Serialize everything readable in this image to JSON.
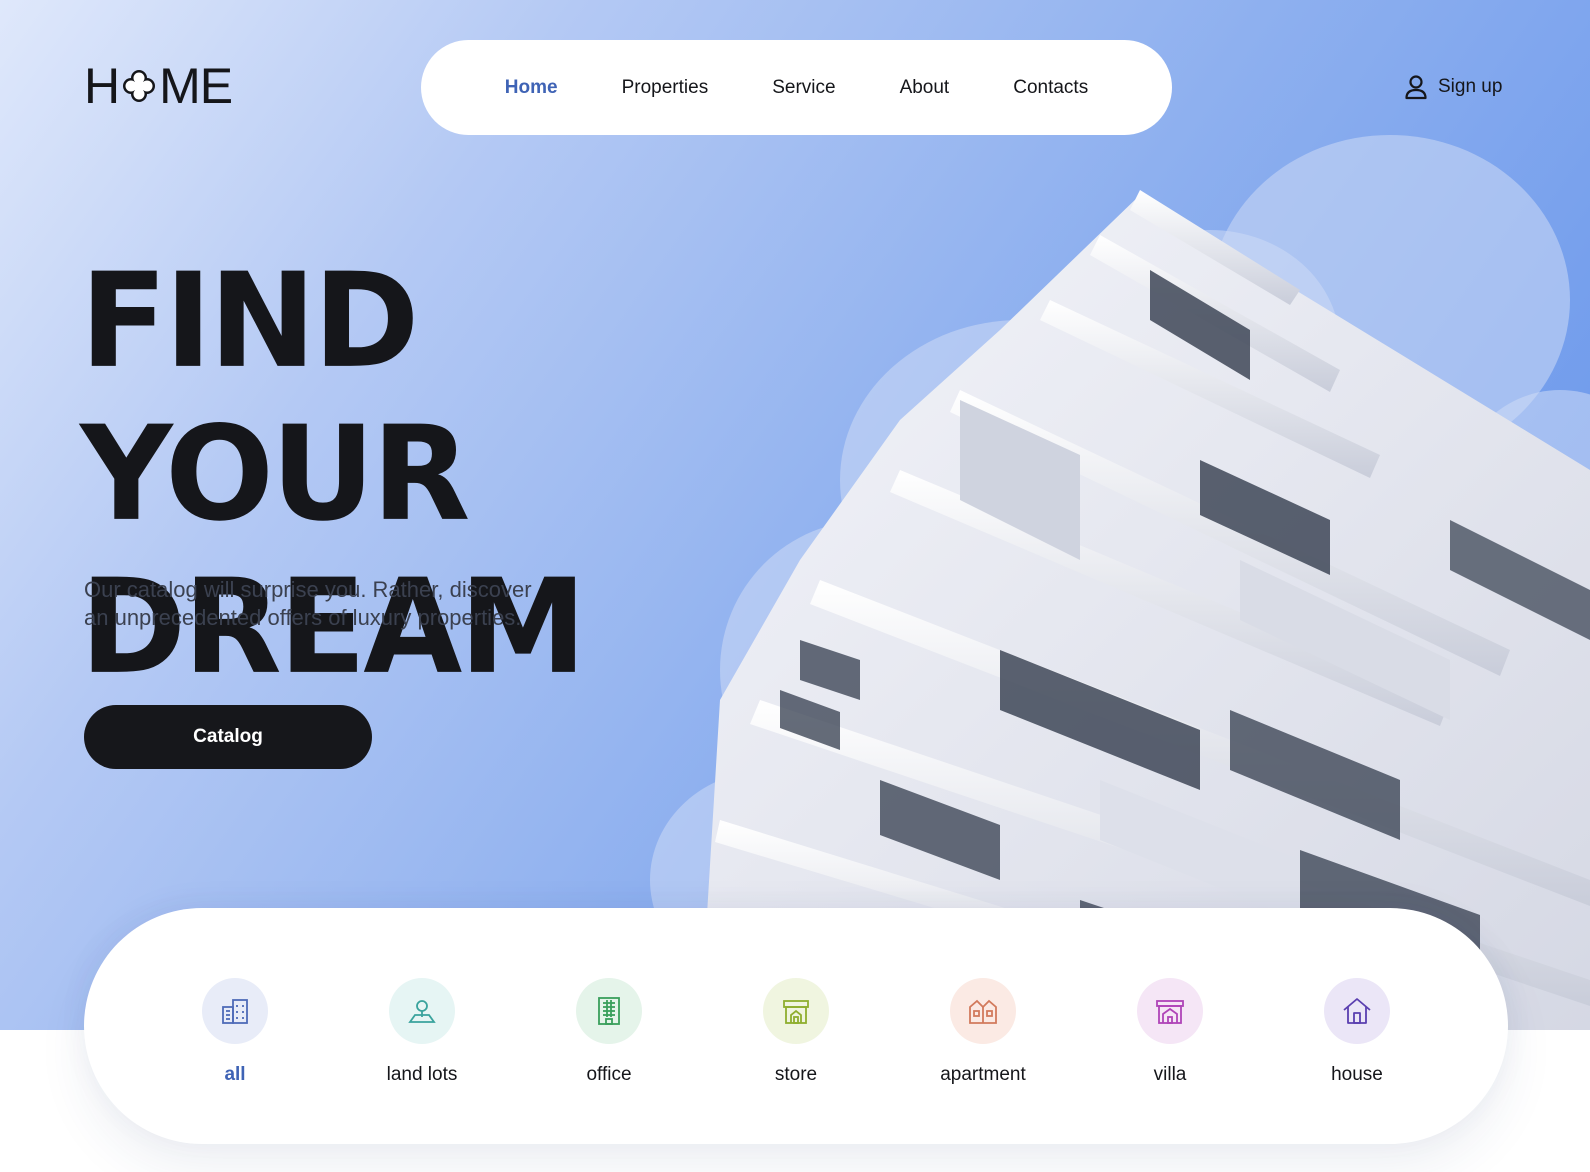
{
  "brand": {
    "logo_prefix": "H",
    "logo_suffix": "ME"
  },
  "nav": {
    "items": [
      {
        "label": "Home",
        "active": true
      },
      {
        "label": "Properties",
        "active": false
      },
      {
        "label": "Service",
        "active": false
      },
      {
        "label": "About",
        "active": false
      },
      {
        "label": "Contacts",
        "active": false
      }
    ]
  },
  "account": {
    "signup_label": "Sign up",
    "icon": "user-icon"
  },
  "hero": {
    "headline_line1": "FIND YOUR",
    "headline_line2": "DREAM",
    "subtitle_line1": "Our catalog will surprise you. Rather, discover",
    "subtitle_line2": "an unprecedented offers of luxury properties.",
    "cta_label": "Catalog"
  },
  "categories": [
    {
      "label": "all",
      "icon": "buildings-icon",
      "color": "#4f6bb8",
      "bg": "#e8ecf8",
      "active": true
    },
    {
      "label": "land lots",
      "icon": "location-pin-icon",
      "color": "#3aa39d",
      "bg": "#e6f5f4",
      "active": false
    },
    {
      "label": "office",
      "icon": "office-building-icon",
      "color": "#3a9f5c",
      "bg": "#e5f4ea",
      "active": false
    },
    {
      "label": "store",
      "icon": "store-icon",
      "color": "#8fae2e",
      "bg": "#f0f5e0",
      "active": false
    },
    {
      "label": "apartment",
      "icon": "apartment-icon",
      "color": "#d27a5c",
      "bg": "#fbeae4",
      "active": false
    },
    {
      "label": "villa",
      "icon": "villa-icon",
      "color": "#b044b8",
      "bg": "#f5e6f6",
      "active": false
    },
    {
      "label": "house",
      "icon": "house-icon",
      "color": "#5a3fb0",
      "bg": "#ebe6f7",
      "active": false
    }
  ],
  "colors": {
    "accent": "#3f63b5",
    "dark": "#16171b",
    "hero_blue": "#6a97ec"
  }
}
